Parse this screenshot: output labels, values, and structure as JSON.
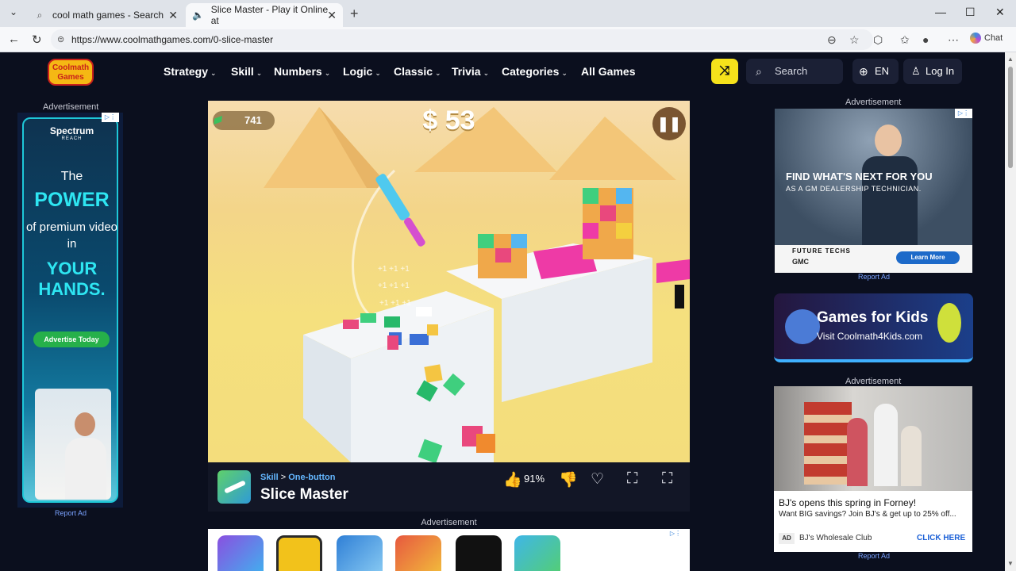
{
  "browser": {
    "tabs": [
      {
        "title": "cool math games - Search",
        "icon": "search-icon"
      },
      {
        "title": "Slice Master - Play it Online at",
        "icon": "speaker-icon"
      }
    ],
    "url": "https://www.coolmathgames.com/0-slice-master",
    "chat_label": "Chat"
  },
  "site": {
    "logo_text": "Coolmath Games",
    "nav": [
      {
        "label": "Strategy"
      },
      {
        "label": "Skill"
      },
      {
        "label": "Numbers"
      },
      {
        "label": "Logic"
      },
      {
        "label": "Classic"
      },
      {
        "label": "Trivia"
      },
      {
        "label": "Categories"
      },
      {
        "label": "All Games"
      }
    ],
    "search_label": "Search",
    "lang_label": "EN",
    "login_label": "Log In"
  },
  "left_ad": {
    "label": "Advertisement",
    "brand": "Spectrum",
    "brand_sub": "REACH",
    "line1": "The",
    "line2": "POWER",
    "line3": "of premium video in",
    "line4": "YOUR HANDS.",
    "cta": "Advertise Today",
    "report": "Report Ad"
  },
  "game": {
    "money": "741",
    "score": "$ 53",
    "plus_text": "+1 +1 +1",
    "category": "Skill",
    "separator": ">",
    "subcategory": "One-button",
    "title": "Slice Master",
    "like_percent": "91%"
  },
  "right_ads": {
    "ad1_label": "Advertisement",
    "ad1_headline": "FIND WHAT'S NEXT FOR YOU",
    "ad1_sub": "AS A GM DEALERSHIP TECHNICIAN.",
    "ad1_footer": "FUTURE TECHS",
    "ad1_logos": "GMC",
    "ad1_cta": "Learn More",
    "ad1_report": "Report Ad",
    "kids_title": "Games for Kids",
    "kids_sub": "Visit Coolmath4Kids.com",
    "ad2_label": "Advertisement",
    "ad2_headline": "BJ's opens this spring in Forney!",
    "ad2_sub": "Want BIG savings? Join BJ's & get up to 25% off...",
    "ad2_badge": "AD",
    "ad2_advertiser": "BJ's Wholesale Club",
    "ad2_cta": "CLICK HERE",
    "ad2_report": "Report Ad"
  },
  "bottom_ad": {
    "label": "Advertisement",
    "thumb_colors": [
      "#8a4fe0",
      "#f2c21b",
      "#2f7fd6",
      "#e7583f",
      "#111111",
      "#3fb6e8"
    ]
  }
}
